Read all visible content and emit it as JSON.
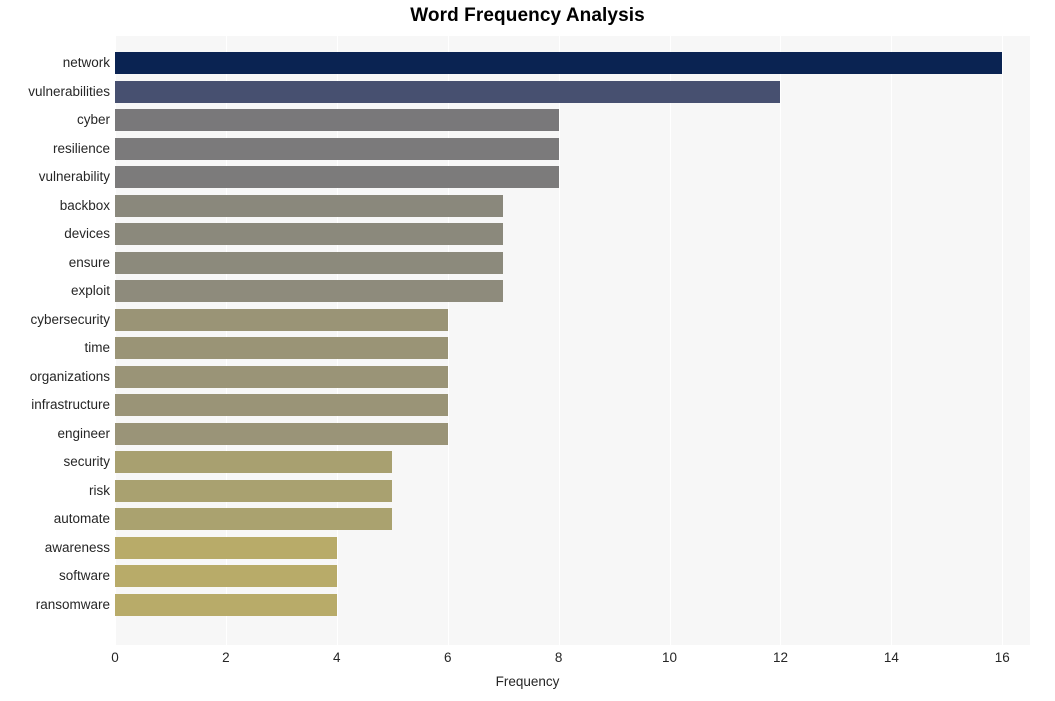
{
  "chart_data": {
    "type": "bar",
    "orientation": "horizontal",
    "title": "Word Frequency Analysis",
    "xlabel": "Frequency",
    "ylabel": "",
    "xlim": [
      0,
      16.5
    ],
    "xticks": [
      0,
      2,
      4,
      6,
      8,
      10,
      12,
      14,
      16
    ],
    "grid": true,
    "grid_axis": "x",
    "legend": "none",
    "categories": [
      "network",
      "vulnerabilities",
      "cyber",
      "resilience",
      "vulnerability",
      "backbox",
      "devices",
      "ensure",
      "exploit",
      "cybersecurity",
      "time",
      "organizations",
      "infrastructure",
      "engineer",
      "security",
      "risk",
      "automate",
      "awareness",
      "software",
      "ransomware"
    ],
    "values": [
      16,
      12,
      8,
      8,
      8,
      7,
      7,
      7,
      7,
      6,
      6,
      6,
      6,
      6,
      5,
      5,
      5,
      4,
      4,
      4
    ],
    "bar_colors": [
      "#0a2352",
      "#475070",
      "#79787a",
      "#7b7a7b",
      "#7c7b7b",
      "#8a887c",
      "#8b897c",
      "#8c8a7c",
      "#8e8b7c",
      "#9a9476",
      "#9a9476",
      "#9a9477",
      "#9a9477",
      "#9a9478",
      "#a8a070",
      "#a9a170",
      "#aaa26f",
      "#b8ab69",
      "#b8ab69",
      "#b8ab69"
    ]
  },
  "style": {
    "plot_background": "#f7f7f7",
    "figure_background": "#ffffff",
    "gridline_color": "#ffffff",
    "text_color": "#262626"
  }
}
